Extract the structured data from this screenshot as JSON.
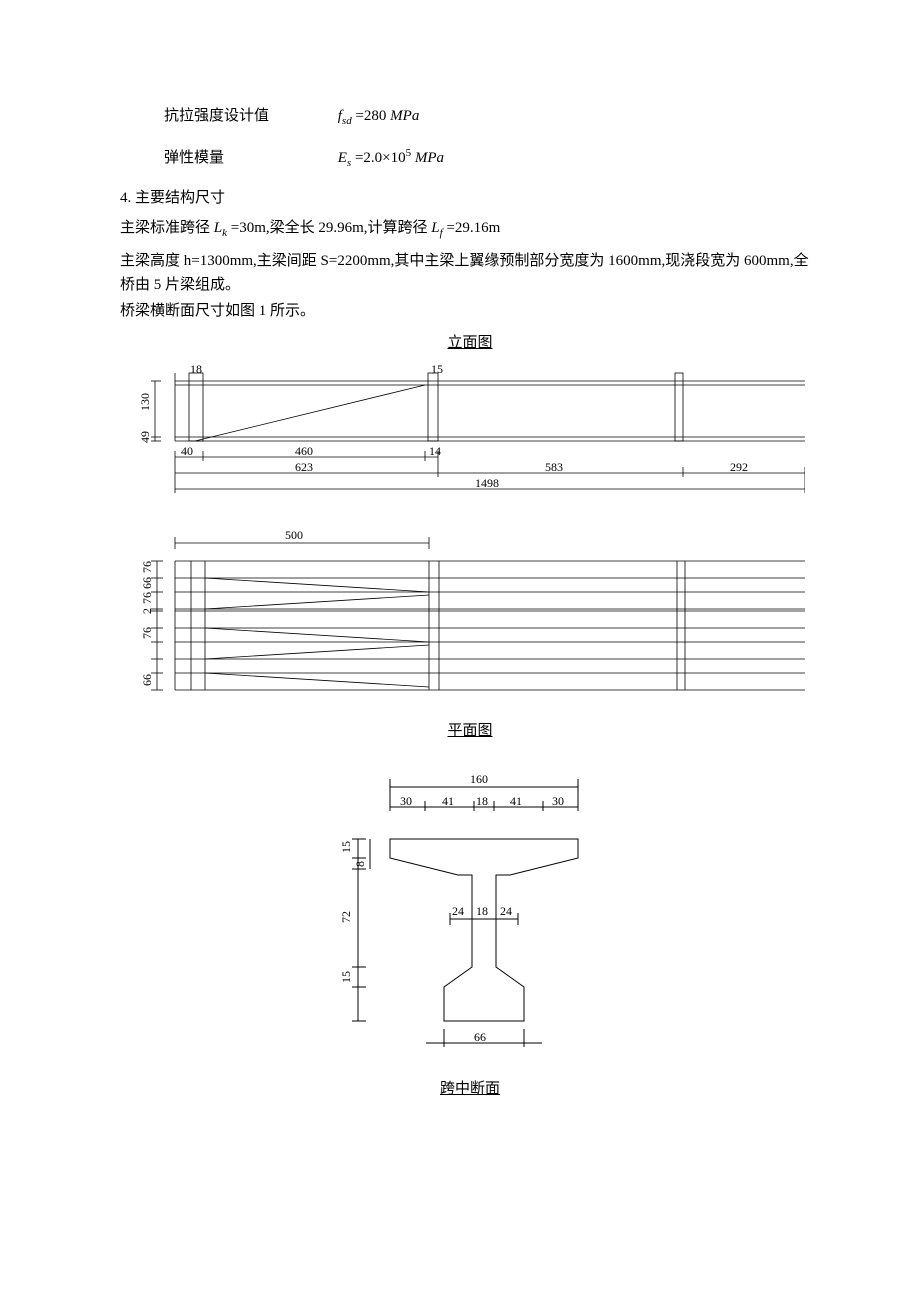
{
  "spec": {
    "tensile_label": "抗拉强度设计值",
    "tensile_sym_base": "f",
    "tensile_sym_sub": "sd",
    "tensile_val": " =280 ",
    "tensile_unit": "MPa",
    "elastic_label": "弹性模量",
    "elastic_sym_base": "E",
    "elastic_sym_sub": "s",
    "elastic_val_pre": " =2.0×10",
    "elastic_val_sup": "5",
    "elastic_unit": " MPa"
  },
  "section4": {
    "heading": "4.  主要结构尺寸",
    "p1_pre": "主梁标准跨径",
    "p1_lk_base": "L",
    "p1_lk_sub": "k",
    "p1_mid": " =30m,梁全长 29.96m,计算跨径",
    "p1_lf_base": "L",
    "p1_lf_sub": "f",
    "p1_end": " =29.16m",
    "p2": "主梁高度 h=1300mm,主梁间距 S=2200mm,其中主梁上翼缘预制部分宽度为 1600mm,现浇段宽为 600mm,全桥由 5 片梁组成。",
    "p3": "桥梁横断面尺寸如图 1 所示。"
  },
  "figs": {
    "elev_title": "立面图",
    "plan_title": "平面图",
    "cross_title": " 跨中断面"
  },
  "elevation": {
    "top_dim1": "18",
    "top_dim2": "15",
    "left_dim1": "130",
    "left_dim2": "49",
    "bot_small1": "40",
    "bot_small2": "460",
    "bot_mid": "14",
    "bot1": "623",
    "bot2": "583",
    "bot3": "292",
    "bot_total": "1498"
  },
  "plan": {
    "top_dim": "500",
    "left1": "76",
    "left2": "66",
    "left3": "76",
    "left4": "2",
    "left5": "76",
    "left6": "66"
  },
  "cross": {
    "top_total": "160",
    "top1": "30",
    "top2": "41",
    "top3": "18",
    "top4": "41",
    "top5": "30",
    "left1": "15",
    "left2": "8",
    "left3": "72",
    "left4": "15",
    "web1": "24",
    "web2": "18",
    "web3": "24",
    "bottom": "66"
  }
}
